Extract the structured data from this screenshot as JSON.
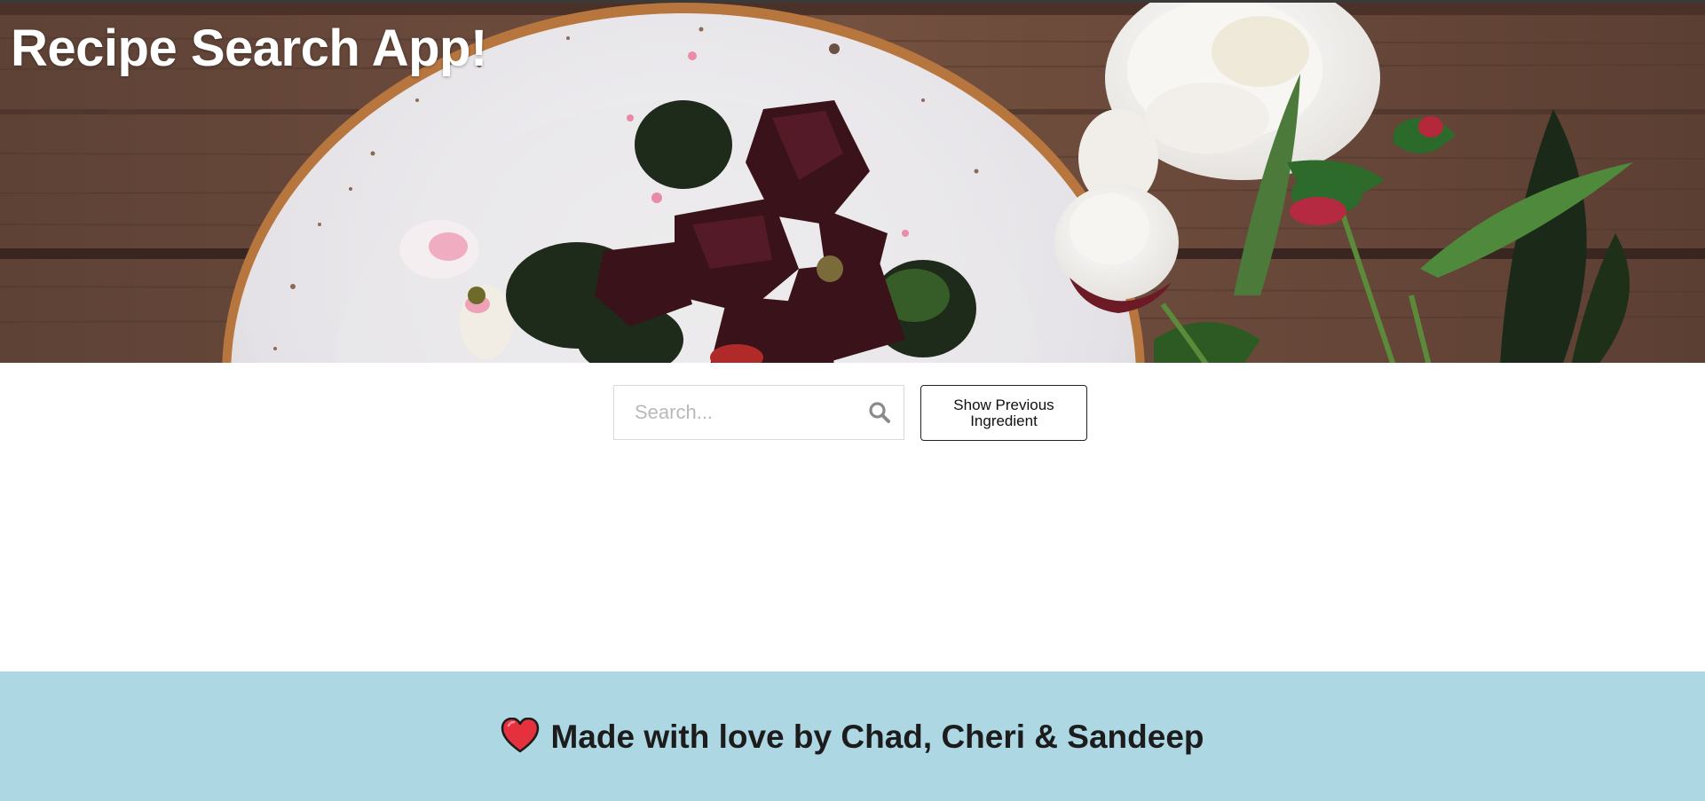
{
  "header": {
    "title": "Recipe Search App!",
    "image_subject": "plate-with-beet-salad-and-white-peonies-on-wooden-table"
  },
  "search": {
    "placeholder": "Search...",
    "value": "",
    "icon": "search-icon"
  },
  "buttons": {
    "show_previous_label": "Show Previous Ingredient"
  },
  "footer": {
    "icon": "heart-icon",
    "text": "Made with love by Chad, Cheri & Sandeep"
  },
  "colors": {
    "footer_background": "#acd7e3",
    "heart": "#e5303e",
    "title_text": "#ffffff",
    "wood": "#6b4a3c"
  }
}
